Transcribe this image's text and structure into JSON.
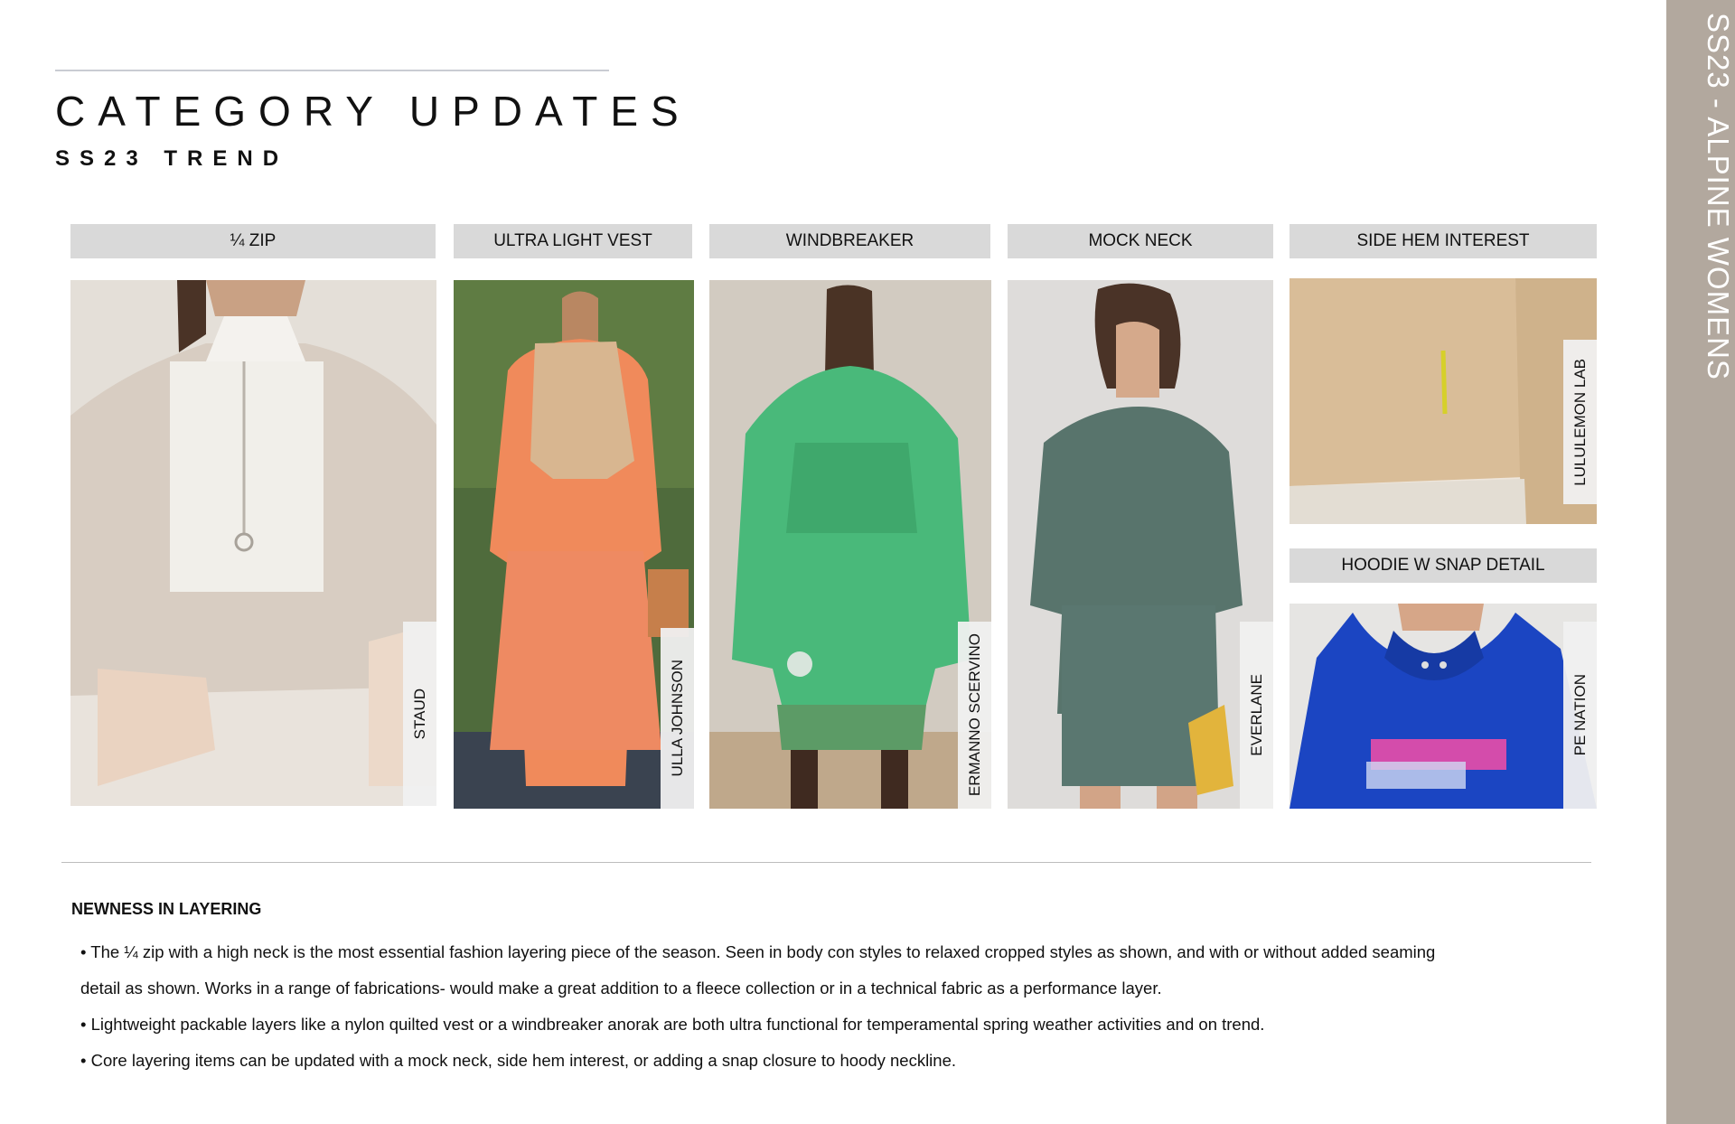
{
  "page": {
    "title": "CATEGORY UPDATES",
    "subtitle": "SS23 TREND",
    "side_title": "SS23 - ALPINE WOMENS"
  },
  "categories": [
    {
      "label": "¼ ZIP",
      "brand": "STAUD"
    },
    {
      "label": "ULTRA LIGHT VEST",
      "brand": "ULLA JOHNSON"
    },
    {
      "label": "WINDBREAKER",
      "brand": "ERMANNO SCERVINO"
    },
    {
      "label": "MOCK NECK",
      "brand": "EVERLANE"
    },
    {
      "label": "SIDE HEM INTEREST",
      "brand": "LULULEMON LAB"
    },
    {
      "label": "HOODIE W SNAP DETAIL",
      "brand": "PE NATION"
    }
  ],
  "notes": {
    "heading": "NEWNESS IN LAYERING",
    "bullet1_line1": "• The ¼ zip with a high neck is the most essential fashion layering piece of the season.  Seen in body con styles to relaxed cropped styles as shown, and with or without added seaming",
    "bullet1_line2": "detail as shown. Works in a range of fabrications- would make a great addition to a fleece collection or in a technical fabric as a performance layer.",
    "bullet2": "• Lightweight packable layers like a nylon quilted vest or a windbreaker anorak are both ultra functional for temperamental spring weather activities and on trend.",
    "bullet3": "• Core layering items can be updated with a mock neck, side hem interest, or adding a snap closure to hoody neckline."
  },
  "colors": {
    "side_band": "#b2a89e",
    "header_fill": "#d9d9d9",
    "rule": "#c9ccd3"
  }
}
